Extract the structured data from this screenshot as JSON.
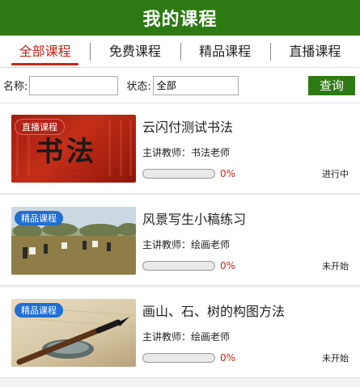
{
  "header": {
    "title": "我的课程"
  },
  "tabs": [
    {
      "label": "全部课程",
      "active": true
    },
    {
      "label": "免费课程",
      "active": false
    },
    {
      "label": "精品课程",
      "active": false
    },
    {
      "label": "直播课程",
      "active": false
    }
  ],
  "filter": {
    "name_label": "名称:",
    "name_value": "",
    "status_label": "状态:",
    "status_value": "全部",
    "query_label": "查询"
  },
  "courses": [
    {
      "badge": "直播课程",
      "thumb_text": "书法",
      "title": "云闪付测试书法",
      "teacher": "主讲教师：书法老师",
      "progress": 0,
      "progress_text": "0%",
      "status": "进行中"
    },
    {
      "badge": "精品课程",
      "title": "风景写生小稿练习",
      "teacher": "主讲教师：绘画老师",
      "progress": 0,
      "progress_text": "0%",
      "status": "未开始"
    },
    {
      "badge": "精品课程",
      "title": "画山、石、树的构图方法",
      "teacher": "主讲教师：绘画老师",
      "progress": 0,
      "progress_text": "0%",
      "status": "未开始"
    }
  ],
  "colors": {
    "header_bg": "#2e7a12",
    "tab_active": "#c0281a",
    "query_bg": "#2e7a12",
    "live_badge": "#b22318",
    "premium_badge": "#1f6fd4"
  }
}
